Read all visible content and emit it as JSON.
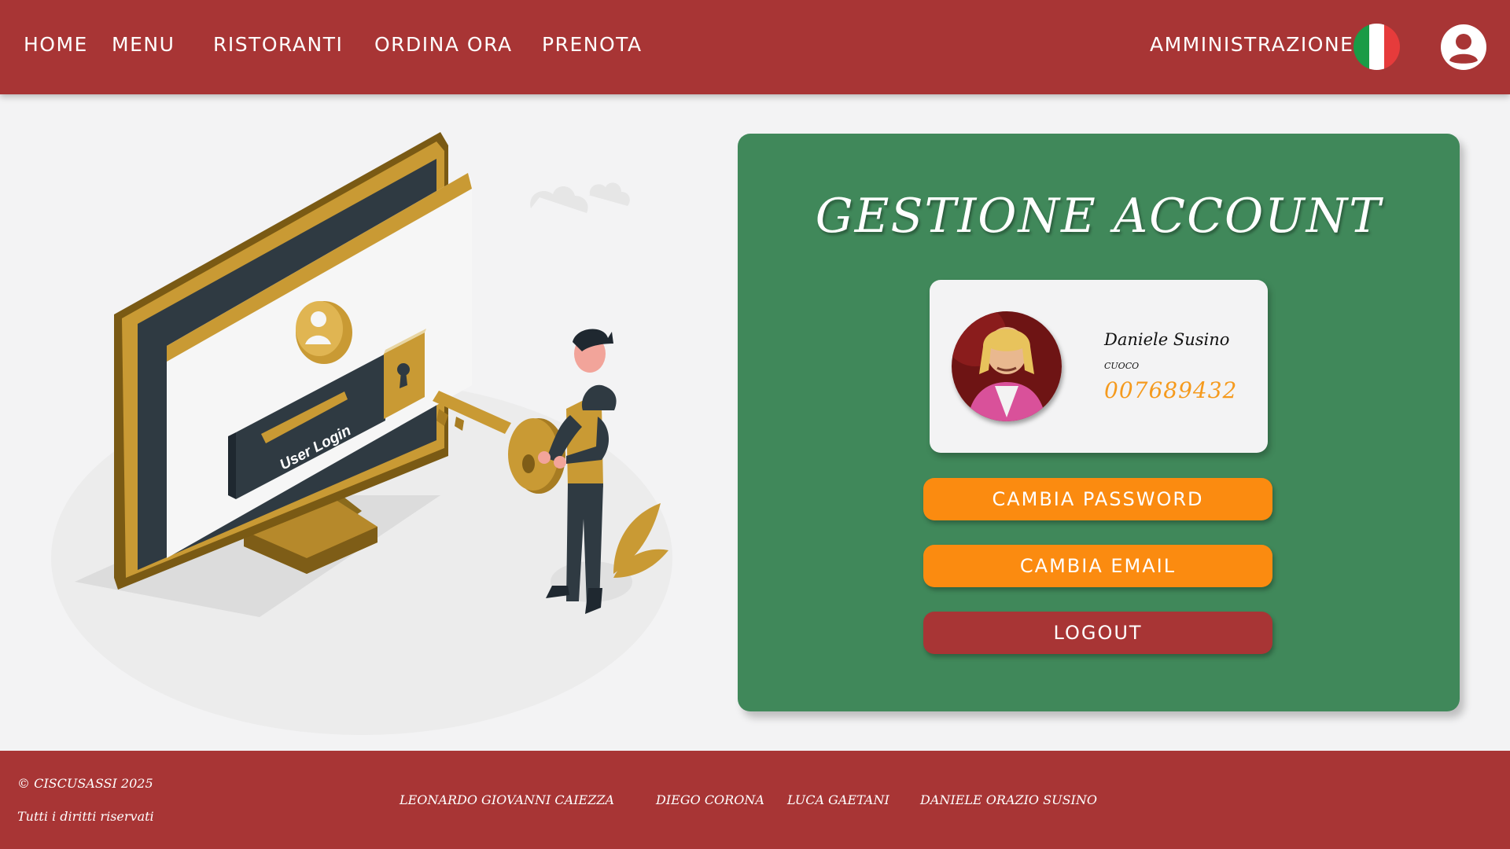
{
  "nav": {
    "items": [
      "HOME",
      "MENU",
      "RISTORANTI",
      "ORDINA ORA",
      "PRENOTA"
    ],
    "admin": "AMMINISTRAZIONE",
    "flag_colors": [
      "#1a9b46",
      "#ffffff",
      "#e63b3b"
    ],
    "language_icon": "italian-flag-icon",
    "user_icon": "user-circle-icon"
  },
  "illustration": {
    "login_label": "User Login"
  },
  "account": {
    "title": "GESTIONE ACCOUNT",
    "name": "Daniele Susino",
    "role": "cuoco",
    "phone": "007689432",
    "buttons": {
      "change_password": "CAMBIA PASSWORD",
      "change_email": "CAMBIA EMAIL",
      "logout": "LOGOUT"
    }
  },
  "footer": {
    "copyright": "© CISCUSASSI 2025",
    "rights": "Tutti i diritti riservati",
    "authors": [
      "LEONARDO GIOVANNI CAIEZZA",
      "DIEGO CORONA",
      "LUCA GAETANI",
      "DANIELE ORAZIO SUSINO"
    ]
  },
  "colors": {
    "brand_red": "#a83535",
    "panel_green": "#40885a",
    "accent_orange": "#fb8b10",
    "phone_orange": "#f59a1d",
    "illustration_gold": "#c99a34"
  }
}
